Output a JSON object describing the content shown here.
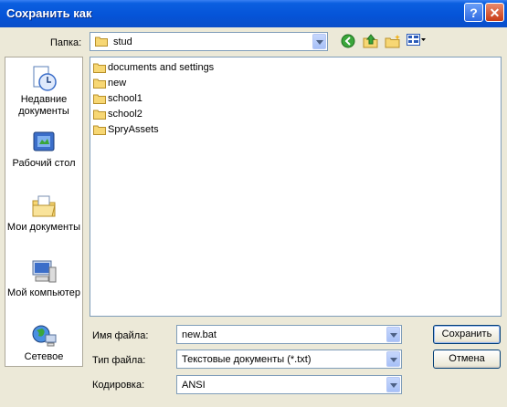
{
  "window": {
    "title": "Сохранить как",
    "help_icon": "?",
    "close_icon": "✕"
  },
  "lookin": {
    "label": "Папка:",
    "value": "stud"
  },
  "toolbar": {
    "icons": [
      "back-icon",
      "up-folder-icon",
      "new-folder-icon",
      "view-menu-icon"
    ]
  },
  "places": [
    {
      "label": "Недавние документы",
      "icon": "recent-documents-icon"
    },
    {
      "label": "Рабочий стол",
      "icon": "desktop-icon"
    },
    {
      "label": "Мои документы",
      "icon": "my-documents-icon"
    },
    {
      "label": "Мой компьютер",
      "icon": "my-computer-icon"
    },
    {
      "label": "Сетевое",
      "icon": "network-icon"
    }
  ],
  "files": [
    {
      "name": "documents and settings"
    },
    {
      "name": "new"
    },
    {
      "name": "school1"
    },
    {
      "name": "school2"
    },
    {
      "name": "SpryAssets"
    }
  ],
  "filename": {
    "label": "Имя файла:",
    "value": "new.bat"
  },
  "filetype": {
    "label": "Тип файла:",
    "value": "Текстовые документы (*.txt)"
  },
  "encoding": {
    "label": "Кодировка:",
    "value": "ANSI"
  },
  "buttons": {
    "save": "Сохранить",
    "cancel": "Отмена"
  },
  "colors": {
    "titlebar": "#0554d8",
    "folder": "#f7d774",
    "dialog_bg": "#ece9d8"
  }
}
